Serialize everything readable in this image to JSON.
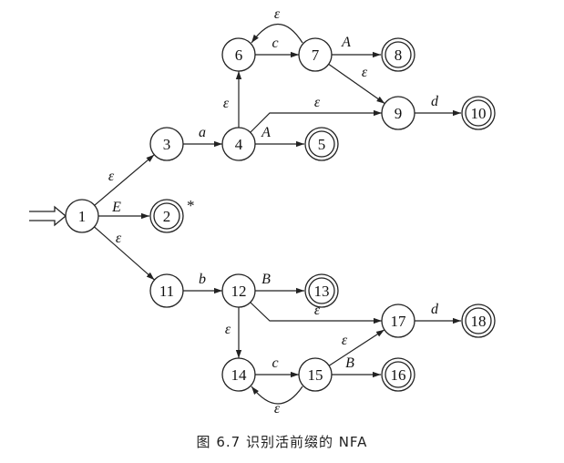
{
  "diagram": {
    "states": [
      {
        "id": "1",
        "label": "1",
        "final": false
      },
      {
        "id": "2",
        "label": "2",
        "final": true,
        "mark": "*"
      },
      {
        "id": "3",
        "label": "3",
        "final": false
      },
      {
        "id": "4",
        "label": "4",
        "final": false
      },
      {
        "id": "5",
        "label": "5",
        "final": true
      },
      {
        "id": "6",
        "label": "6",
        "final": false
      },
      {
        "id": "7",
        "label": "7",
        "final": false
      },
      {
        "id": "8",
        "label": "8",
        "final": true
      },
      {
        "id": "9",
        "label": "9",
        "final": false
      },
      {
        "id": "10",
        "label": "10",
        "final": true
      },
      {
        "id": "11",
        "label": "11",
        "final": false
      },
      {
        "id": "12",
        "label": "12",
        "final": false
      },
      {
        "id": "13",
        "label": "13",
        "final": true
      },
      {
        "id": "14",
        "label": "14",
        "final": false
      },
      {
        "id": "15",
        "label": "15",
        "final": false
      },
      {
        "id": "16",
        "label": "16",
        "final": true
      },
      {
        "id": "17",
        "label": "17",
        "final": false
      },
      {
        "id": "18",
        "label": "18",
        "final": true
      }
    ],
    "start_state": "1",
    "transitions": [
      {
        "from": "1",
        "to": "3",
        "label": "ε"
      },
      {
        "from": "1",
        "to": "2",
        "label": "E"
      },
      {
        "from": "1",
        "to": "11",
        "label": "ε"
      },
      {
        "from": "3",
        "to": "4",
        "label": "a"
      },
      {
        "from": "4",
        "to": "5",
        "label": "A"
      },
      {
        "from": "4",
        "to": "6",
        "label": "ε"
      },
      {
        "from": "4",
        "to": "9",
        "label": "ε"
      },
      {
        "from": "6",
        "to": "7",
        "label": "c"
      },
      {
        "from": "7",
        "to": "6",
        "label": "ε"
      },
      {
        "from": "7",
        "to": "8",
        "label": "A"
      },
      {
        "from": "7",
        "to": "9",
        "label": "ε"
      },
      {
        "from": "9",
        "to": "10",
        "label": "d"
      },
      {
        "from": "11",
        "to": "12",
        "label": "b"
      },
      {
        "from": "12",
        "to": "13",
        "label": "B"
      },
      {
        "from": "12",
        "to": "17",
        "label": "ε"
      },
      {
        "from": "12",
        "to": "14",
        "label": "ε"
      },
      {
        "from": "14",
        "to": "15",
        "label": "c"
      },
      {
        "from": "15",
        "to": "14",
        "label": "ε"
      },
      {
        "from": "15",
        "to": "16",
        "label": "B"
      },
      {
        "from": "15",
        "to": "17",
        "label": "ε"
      },
      {
        "from": "17",
        "to": "18",
        "label": "d"
      }
    ]
  },
  "caption": "图 6.7   识别活前缀的 NFA"
}
